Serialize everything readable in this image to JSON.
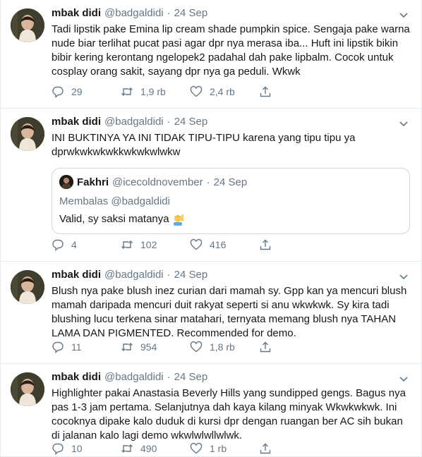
{
  "tweets": [
    {
      "name": "mbak didi",
      "handle": "@badgaldidi",
      "separator": "·",
      "time": "24 Sep",
      "text": "Tadi lipstik pake Emina lip cream shade pumpkin spice. Sengaja pake warna\nnude biar terlihat pucat pasi agar dpr nya merasa iba... Huft ini lipstik bikin\nbibir kering kerontang ngelopek2 padahal dah pake lipbalm. Cocok untuk\ncosplay orang sakit, sayang dpr nya ga peduli. Wkwk",
      "replies": "29",
      "retweets": "1,9 rb",
      "likes": "2,4 rb"
    },
    {
      "name": "mbak didi",
      "handle": "@badgaldidi",
      "separator": "·",
      "time": "24 Sep",
      "text": "INI BUKTINYA YA INI TIDAK TIPU-TIPU karena yang tipu tipu ya\ndprwkwkwkwkkwkwkwlwkw",
      "quote": {
        "name": "Fakhri",
        "handle": "@icecoldnovember",
        "separator": "·",
        "time": "24 Sep",
        "reply_to": "Membalas @badgaldidi",
        "text": "Valid, sy saksi matanya"
      },
      "replies": "4",
      "retweets": "102",
      "likes": "416"
    },
    {
      "name": "mbak didi",
      "handle": "@badgaldidi",
      "separator": "·",
      "time": "24 Sep",
      "text": "Blush nya pake blush inez curian dari mamah sy. Gpp kan ya mencuri blush\nmamah daripada mencuri duit rakyat seperti si anu wkwkwk. Sy kira tadi\nblushing lucu terkena sinar matahari, ternyata memang blush nya TAHAN\nLAMA DAN PIGMENTED. Recommended for demo.",
      "replies": "11",
      "retweets": "954",
      "likes": "1,8 rb"
    },
    {
      "name": "mbak didi",
      "handle": "@badgaldidi",
      "separator": "·",
      "time": "24 Sep",
      "text": "Highlighter pakai Anastasia Beverly Hills yang sundipped gengs. Bagus nya\npas 1-3 jam pertama. Selanjutnya dah kaya kilang minyak Wkwkwkwk. Ini\ncocoknya dipake kalo duduk di kursi dpr dengan ruangan ber AC sih bukan\ndi jalanan kalo lagi demo wkwlwlwllwlwk.",
      "replies": "10",
      "retweets": "490",
      "likes": "1 rb"
    }
  ],
  "icons": {
    "reply": "reply-icon",
    "retweet": "retweet-icon",
    "like": "heart-icon",
    "share": "share-icon",
    "caret": "chevron-down-icon",
    "quote_emoji": "man-raising-hand-emoji"
  },
  "colors": {
    "text": "#14171a",
    "secondary": "#657786",
    "border": "#e6ecf0",
    "quote_border": "#ccd6dd"
  }
}
